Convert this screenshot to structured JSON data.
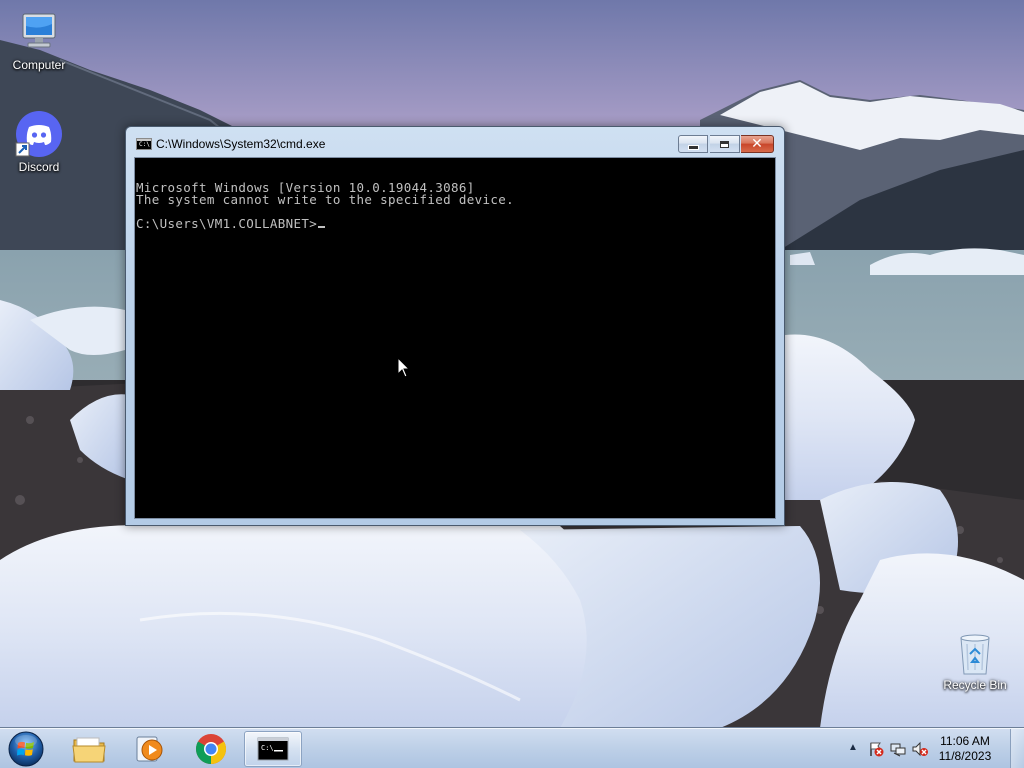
{
  "desktop": {
    "icons": [
      {
        "label": "Computer",
        "icon": "computer-icon"
      },
      {
        "label": "Discord",
        "icon": "discord-icon"
      },
      {
        "label": "Recycle Bin",
        "icon": "recycle-bin-icon"
      }
    ]
  },
  "window": {
    "title": "C:\\Windows\\System32\\cmd.exe",
    "icon": "cmd-icon",
    "console_lines": [
      "Microsoft Windows [Version 10.0.19044.3086]",
      "The system cannot write to the specified device.",
      "",
      "C:\\Users\\VM1.COLLABNET>"
    ],
    "controls": {
      "minimize": "minimize-icon",
      "maximize": "maximize-icon",
      "close": "close-icon"
    },
    "colors": {
      "console_bg": "#000000",
      "console_fg": "#c0c0c0",
      "close_button": "#c8452a"
    }
  },
  "taskbar": {
    "start_icon": "windows-start-icon",
    "pinned": [
      {
        "name": "File Explorer",
        "icon": "folder-icon"
      },
      {
        "name": "Windows Media Player",
        "icon": "media-player-icon"
      },
      {
        "name": "Google Chrome",
        "icon": "chrome-icon"
      },
      {
        "name": "Command Prompt",
        "icon": "cmd-icon",
        "active": true
      }
    ],
    "tray": {
      "icons": [
        "show-hidden-arrow-icon",
        "action-center-flag-icon",
        "network-icon",
        "volume-muted-icon"
      ],
      "time": "11:06 AM",
      "date": "11/8/2023"
    }
  }
}
